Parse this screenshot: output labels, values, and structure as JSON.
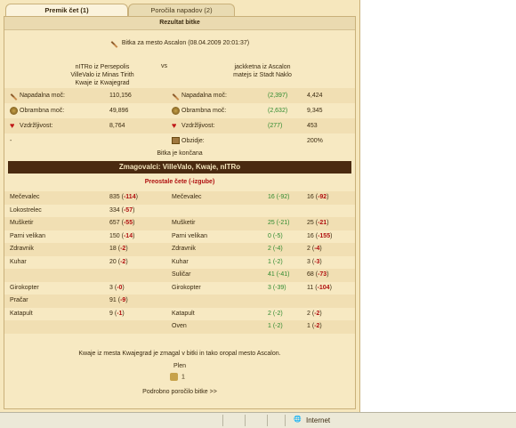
{
  "tabs": [
    {
      "label": "Premik čet (1)"
    },
    {
      "label": "Poročila napadov (2)"
    }
  ],
  "report": {
    "header": "Rezultat bitke",
    "title": "Bitka za mesto Ascalon (08.04.2009 20:01:37)",
    "attacker_lines": [
      "nITRo iz Persepolis",
      "VilleValo iz Minas Tirith",
      "Kwaje iz Kwajegrad"
    ],
    "vs": "vs",
    "defender_lines": [
      "jackketna iz Ascalon",
      "matejs iz Stadt Naklo"
    ],
    "stats": [
      {
        "label": "Napadalna moč:",
        "att": "110,156",
        "def_change": "(2,397)",
        "def": "4,424",
        "icon": "sword-icon"
      },
      {
        "label": "Obrambna moč:",
        "att": "49,896",
        "def_change": "(2,632)",
        "def": "9,345",
        "icon": "shield-icon"
      },
      {
        "label": "Vzdržljivost:",
        "att": "8,764",
        "def_change": "(277)",
        "def": "453",
        "icon": "heart-icon"
      }
    ],
    "wall": {
      "att": "-",
      "label": "Obzidje:",
      "value": "200%"
    },
    "ended": "Bitka je končana",
    "winners": "Zmagovalci: VilleValo, Kwaje, nITRo",
    "remaining_header": "Preostale čete (-izgube)",
    "units_left": [
      {
        "name": "Mečevalec",
        "count": "835",
        "loss": "-114"
      },
      {
        "name": "Lokostrelec",
        "count": "334",
        "loss": "-57"
      },
      {
        "name": "Mušketir",
        "count": "657",
        "loss": "-55"
      },
      {
        "name": "Parni velikan",
        "count": "150",
        "loss": "-14"
      },
      {
        "name": "Zdravnik",
        "count": "18",
        "loss": "-2"
      },
      {
        "name": "Kuhar",
        "count": "20",
        "loss": "-2"
      },
      {
        "name": "",
        "count": "",
        "loss": ""
      },
      {
        "name": "Girokopter",
        "count": "3",
        "loss": "-0"
      },
      {
        "name": "Pračar",
        "count": "91",
        "loss": "-9"
      },
      {
        "name": "Katapult",
        "count": "9",
        "loss": "-1"
      }
    ],
    "units_right": [
      {
        "name": "Mečevalec",
        "a": "16 (-92)",
        "b": "16",
        "bloss": "-92"
      },
      {
        "name": "",
        "a": "",
        "b": "",
        "bloss": ""
      },
      {
        "name": "Mušketir",
        "a": "25 (-21)",
        "b": "25",
        "bloss": "-21"
      },
      {
        "name": "Parni velikan",
        "a": "0 (-5)",
        "b": "16",
        "bloss": "-155"
      },
      {
        "name": "Zdravnik",
        "a": "2 (-4)",
        "b": "2",
        "bloss": "-4"
      },
      {
        "name": "Kuhar",
        "a": "1 (-2)",
        "b": "3",
        "bloss": "-3"
      },
      {
        "name": "Suličar",
        "a": "41 (-41)",
        "b": "68",
        "bloss": "-73"
      },
      {
        "name": "Girokopter",
        "a": "3 (-39)",
        "b": "11",
        "bloss": "-104"
      },
      {
        "name": "",
        "a": "",
        "b": "",
        "bloss": ""
      },
      {
        "name": "Katapult",
        "a": "2 (-2)",
        "b": "2",
        "bloss": "-2"
      },
      {
        "name": "Oven",
        "a": "1 (-2)",
        "b": "1",
        "bloss": "-2"
      }
    ],
    "summary": "Kwaje iz mesta Kwajegrad je zmagal v bitki in tako oropal mesto Ascalon.",
    "loot_label": "Plen",
    "loot_value": "1",
    "details_link": "Podrobno poročilo bitke >>"
  },
  "statusbar": {
    "zone": "Internet"
  }
}
